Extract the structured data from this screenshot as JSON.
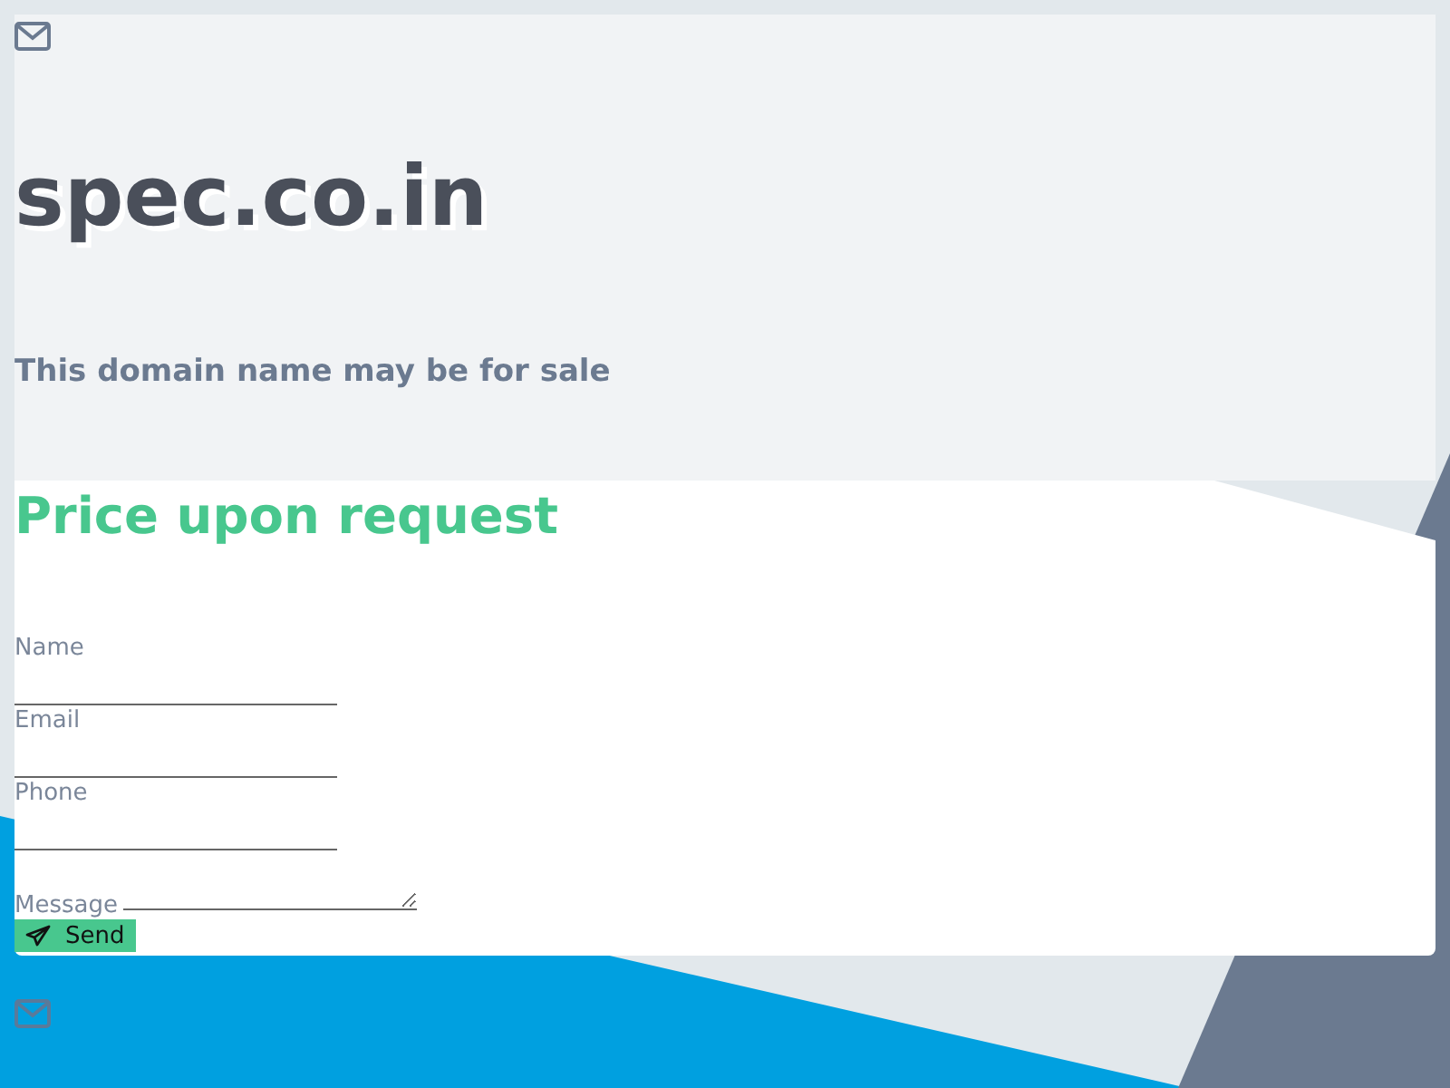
{
  "header": {
    "domain": "spec.co.in",
    "tagline": "This domain name may be for sale"
  },
  "card": {
    "heading": "Price upon request",
    "fields": [
      {
        "label": "Name",
        "kind": "input"
      },
      {
        "label": "Email",
        "kind": "input"
      },
      {
        "label": "Phone",
        "kind": "input"
      },
      {
        "label": "Message",
        "kind": "textarea"
      }
    ],
    "button": "Send"
  }
}
